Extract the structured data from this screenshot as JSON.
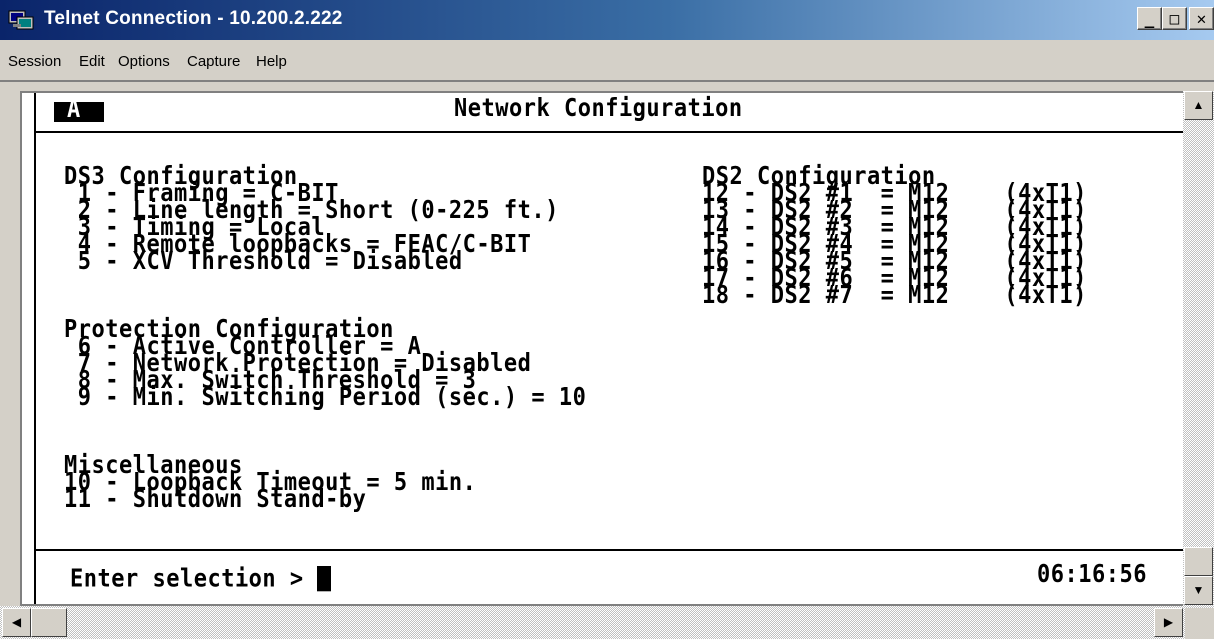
{
  "window": {
    "title": "Telnet Connection - 10.200.2.222",
    "min_glyph": "_",
    "max_glyph": "□",
    "close_glyph": "✕"
  },
  "menu": [
    "Session",
    "Edit",
    "Options",
    "Capture",
    "Help"
  ],
  "terminal": {
    "controller_badge": "A",
    "header_title": "Network Configuration",
    "ds3": {
      "heading": "DS3 Configuration",
      "items": [
        " 1 - Framing = C-BIT",
        " 2 - Line length = Short (0-225 ft.)",
        " 3 - Timing = Local",
        " 4 - Remote loopbacks = FEAC/C-BIT",
        " 5 - XCV Threshold = Disabled"
      ]
    },
    "protection": {
      "heading": "Protection Configuration",
      "items": [
        " 6 - Active Controller = A",
        " 7 - Network Protection = Disabled",
        " 8 - Max. Switch Threshold = 3",
        " 9 - Min. Switching Period (sec.) = 10"
      ]
    },
    "misc": {
      "heading": "Miscellaneous",
      "items": [
        "10 - Loopback Timeout = 5 min.",
        "11 - Shutdown Stand-by"
      ]
    },
    "ds2": {
      "heading": "DS2 Configuration",
      "items": [
        "12 - DS2 #1  = M12    (4xT1)",
        "13 - DS2 #2  = M12    (4xT1)",
        "14 - DS2 #3  = M12    (4xT1)",
        "15 - DS2 #4  = M12    (4xT1)",
        "16 - DS2 #5  = M12    (4xT1)",
        "17 - DS2 #6  = M12    (4xT1)",
        "18 - DS2 #7  = M12    (4xT1)"
      ]
    },
    "prompt": "Enter selection > ",
    "clock": "06:16:56"
  },
  "scrollbars": {
    "up_arrow": "▲",
    "down_arrow": "▼",
    "left_arrow": "◀",
    "right_arrow": "▶"
  }
}
